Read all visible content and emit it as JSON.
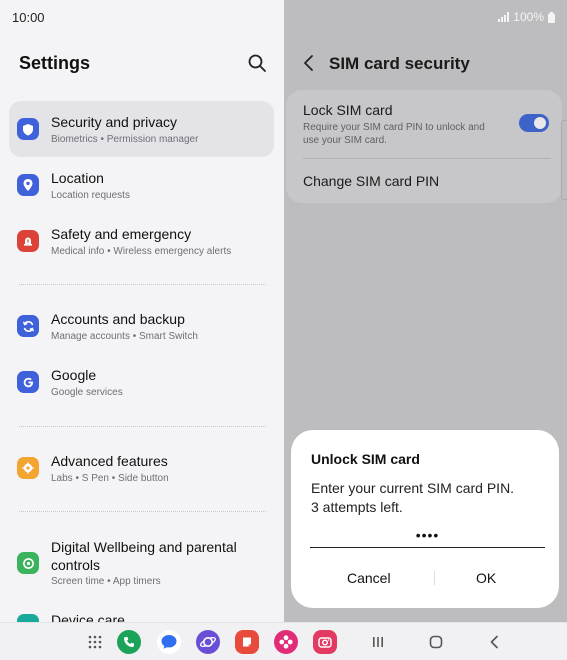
{
  "status": {
    "time": "10:00",
    "battery": "100%"
  },
  "settings": {
    "title": "Settings",
    "items": [
      {
        "title": "Security and privacy",
        "subtitle": "Biometrics  •  Permission manager",
        "icon": "shield-icon",
        "color": "#3f61d9"
      },
      {
        "title": "Location",
        "subtitle": "Location requests",
        "icon": "location-icon",
        "color": "#3f61d9"
      },
      {
        "title": "Safety and emergency",
        "subtitle": "Medical info  •  Wireless emergency alerts",
        "icon": "alert-icon",
        "color": "#dc4338"
      },
      {
        "title": "Accounts and backup",
        "subtitle": "Manage accounts  •  Smart Switch",
        "icon": "sync-icon",
        "color": "#3f61d9"
      },
      {
        "title": "Google",
        "subtitle": "Google services",
        "icon": "google-icon",
        "color": "#3f61d9"
      },
      {
        "title": "Advanced features",
        "subtitle": "Labs  •  S Pen  •  Side button",
        "icon": "gear-plus-icon",
        "color": "#f2a531"
      },
      {
        "title": "Digital Wellbeing and parental controls",
        "subtitle": "Screen time  •  App timers",
        "icon": "wellbeing-icon",
        "color": "#3bb35c"
      },
      {
        "title": "Device care",
        "subtitle": "",
        "icon": "device-care-icon",
        "color": "#19a99a"
      }
    ]
  },
  "sim": {
    "title": "SIM card security",
    "lock_title": "Lock SIM card",
    "lock_desc": "Require your SIM card PIN to unlock and use your SIM card.",
    "lock_enabled": true,
    "change_pin": "Change SIM card PIN"
  },
  "dialog": {
    "title": "Unlock SIM card",
    "message_line1": "Enter your current SIM card PIN.",
    "message_line2": "3 attempts left.",
    "pin_value": "••••",
    "cancel": "Cancel",
    "ok": "OK"
  },
  "taskbar": {
    "apps": [
      "apps-grid-icon",
      "phone-icon",
      "messages-icon",
      "internet-icon",
      "notes-icon",
      "gallery-icon",
      "camera-icon"
    ]
  },
  "colors": {
    "accent": "#3e63c8",
    "toggle_on": "#3e63c8"
  }
}
